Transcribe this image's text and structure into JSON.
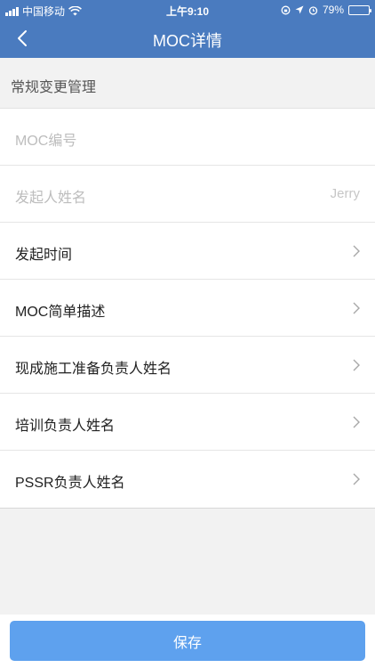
{
  "status_bar": {
    "carrier": "中国移动",
    "time": "上午9:10",
    "battery_text": "79%",
    "battery_level": 0.79
  },
  "navbar": {
    "title": "MOC详情",
    "back_icon": "chevron-left-icon"
  },
  "section": {
    "title": "常规变更管理"
  },
  "rows": [
    {
      "label": "MOC编号",
      "value": ""
    },
    {
      "label": "发起人姓名",
      "value": "Jerry"
    },
    {
      "label": "发起时间"
    },
    {
      "label": "MOC简单描述"
    },
    {
      "label": "现成施工准备负责人姓名"
    },
    {
      "label": "培训负责人姓名"
    },
    {
      "label": "PSSR负责人姓名"
    }
  ],
  "footer": {
    "save_label": "保存"
  },
  "colors": {
    "nav_bg": "#4a7bbf",
    "button_bg": "#5ea1ee",
    "page_bg": "#f2f2f2"
  }
}
